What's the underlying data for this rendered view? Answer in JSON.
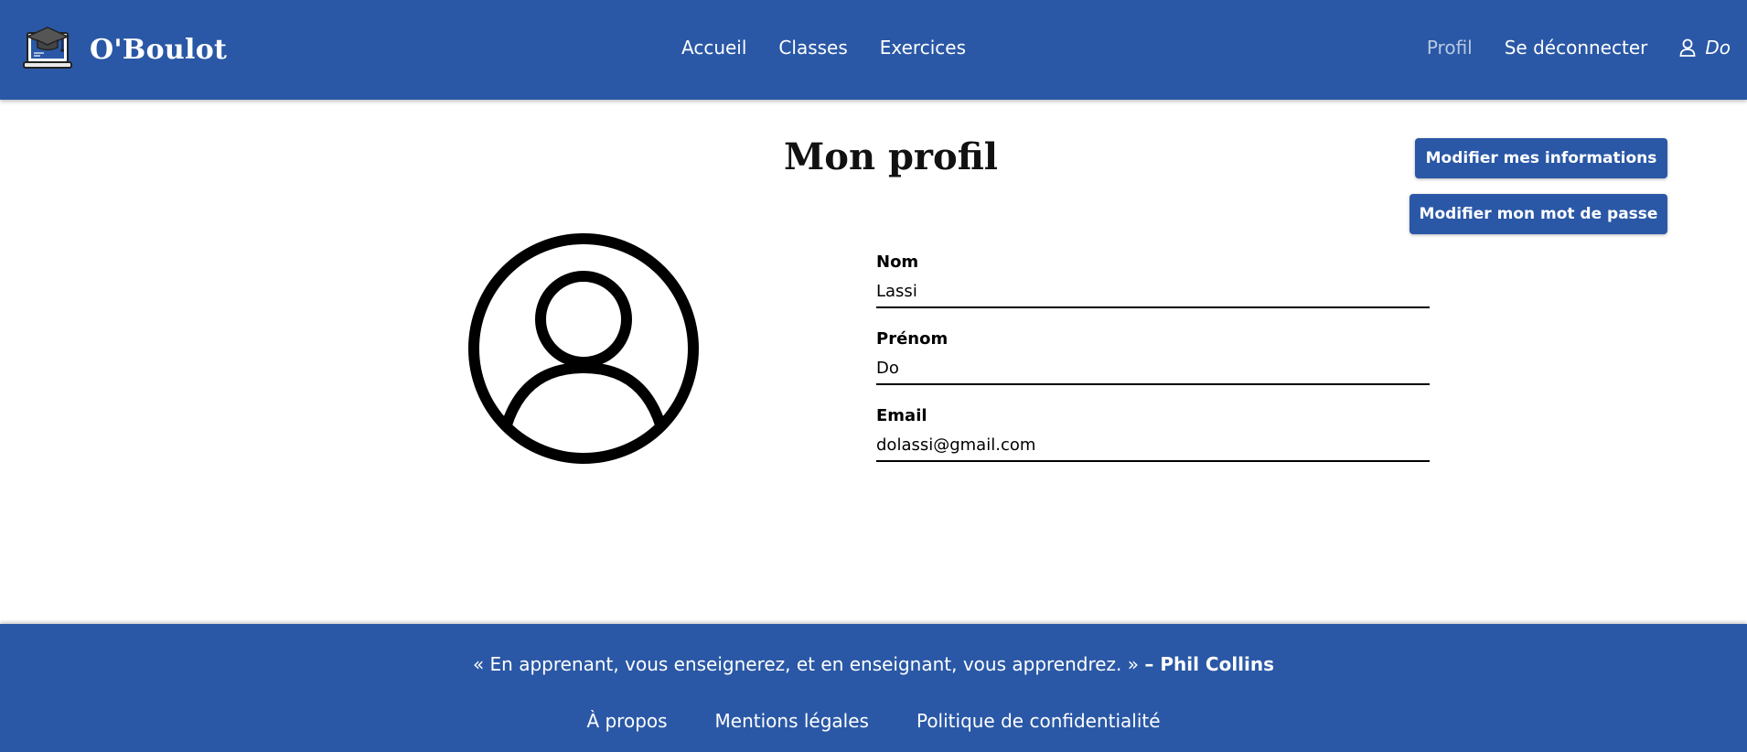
{
  "header": {
    "brand": "O'Boulot",
    "nav": [
      {
        "label": "Accueil"
      },
      {
        "label": "Classes"
      },
      {
        "label": "Exercices"
      }
    ],
    "profile_label": "Profil",
    "logout_label": "Se déconnecter",
    "user_name": "Do"
  },
  "main": {
    "title": "Mon profil",
    "edit_info_label": "Modifier mes informations",
    "edit_password_label": "Modifier mon mot de passe",
    "fields": [
      {
        "label": "Nom",
        "value": "Lassi"
      },
      {
        "label": "Prénom",
        "value": "Do"
      },
      {
        "label": "Email",
        "value": "dolassi@gmail.com"
      }
    ]
  },
  "footer": {
    "quote": "« En apprenant, vous enseignerez, et en enseignant, vous apprendrez. »",
    "author": "– Phil Collins",
    "links": [
      {
        "label": "À propos"
      },
      {
        "label": "Mentions légales"
      },
      {
        "label": "Politique de confidentialité"
      }
    ]
  },
  "colors": {
    "brand_blue": "#2a58a6",
    "active_nav": "#b9c7e2"
  }
}
